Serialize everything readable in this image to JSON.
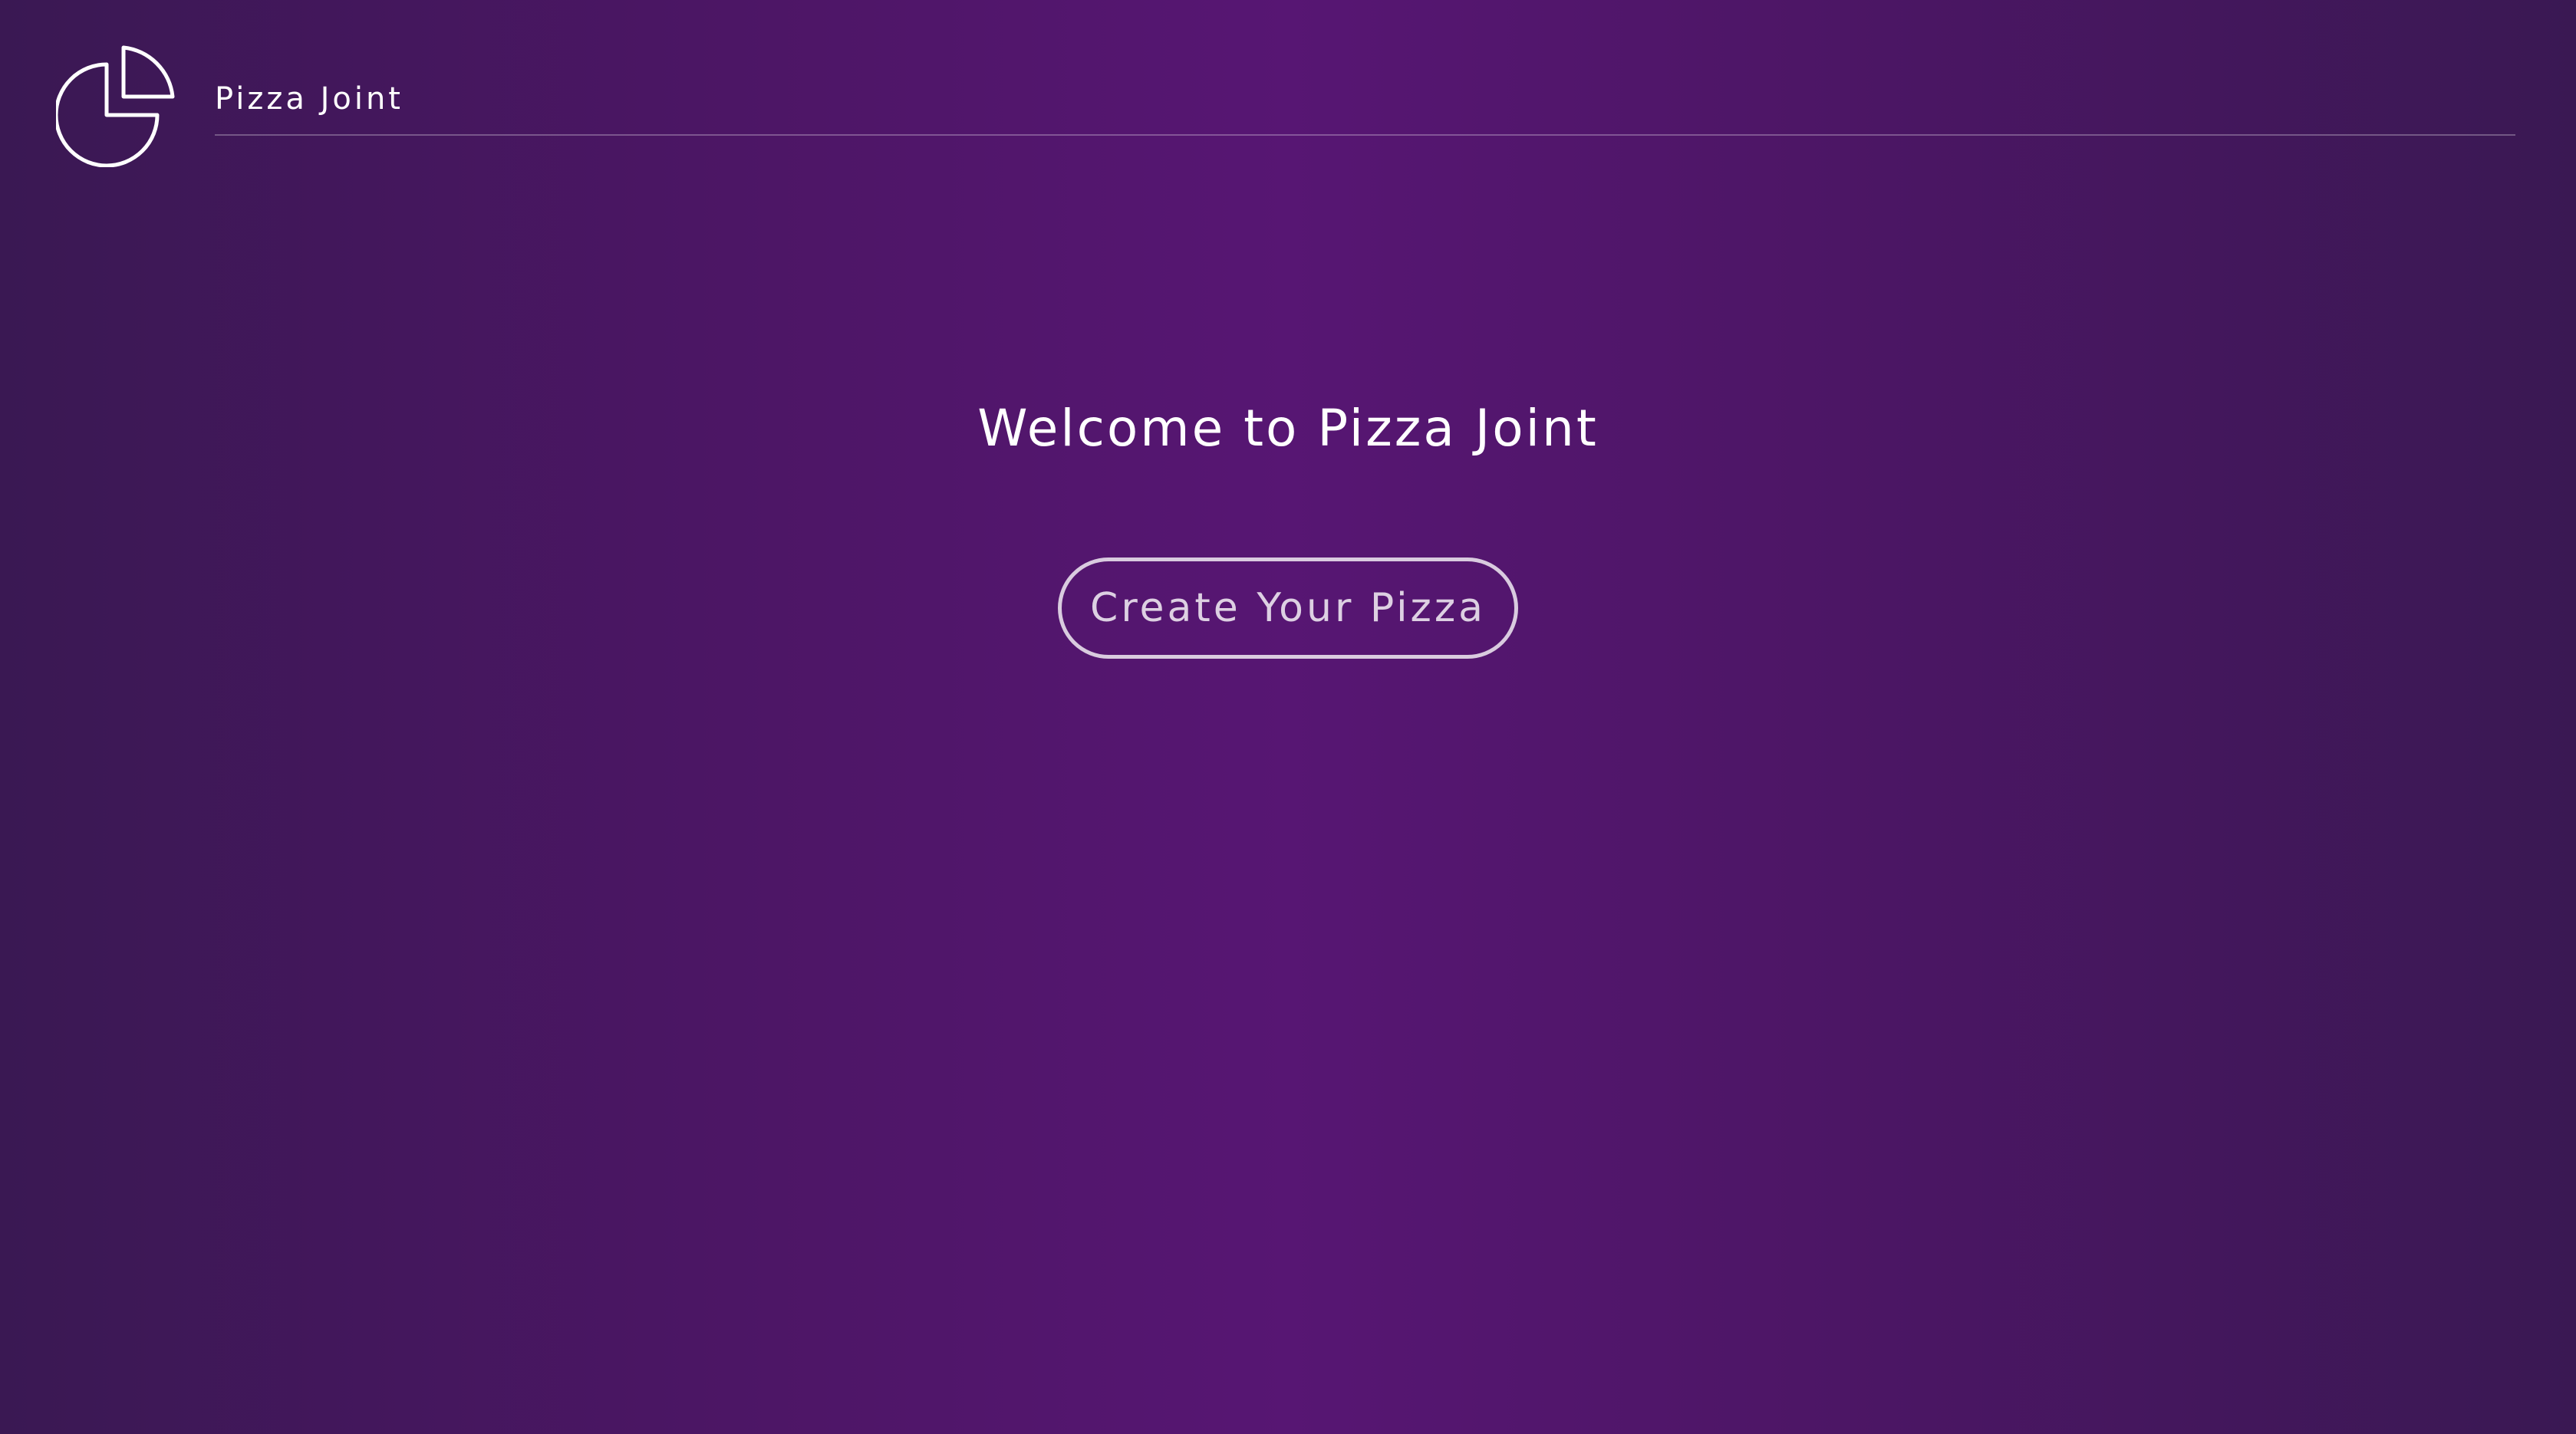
{
  "header": {
    "brand_title": "Pizza Joint",
    "logo_icon": "pie-chart-icon"
  },
  "main": {
    "welcome_title": "Welcome to Pizza Joint",
    "cta_label": "Create Your Pizza"
  },
  "colors": {
    "background_center": "#571673",
    "background_edge": "#3a1853",
    "text": "#ffffff"
  }
}
